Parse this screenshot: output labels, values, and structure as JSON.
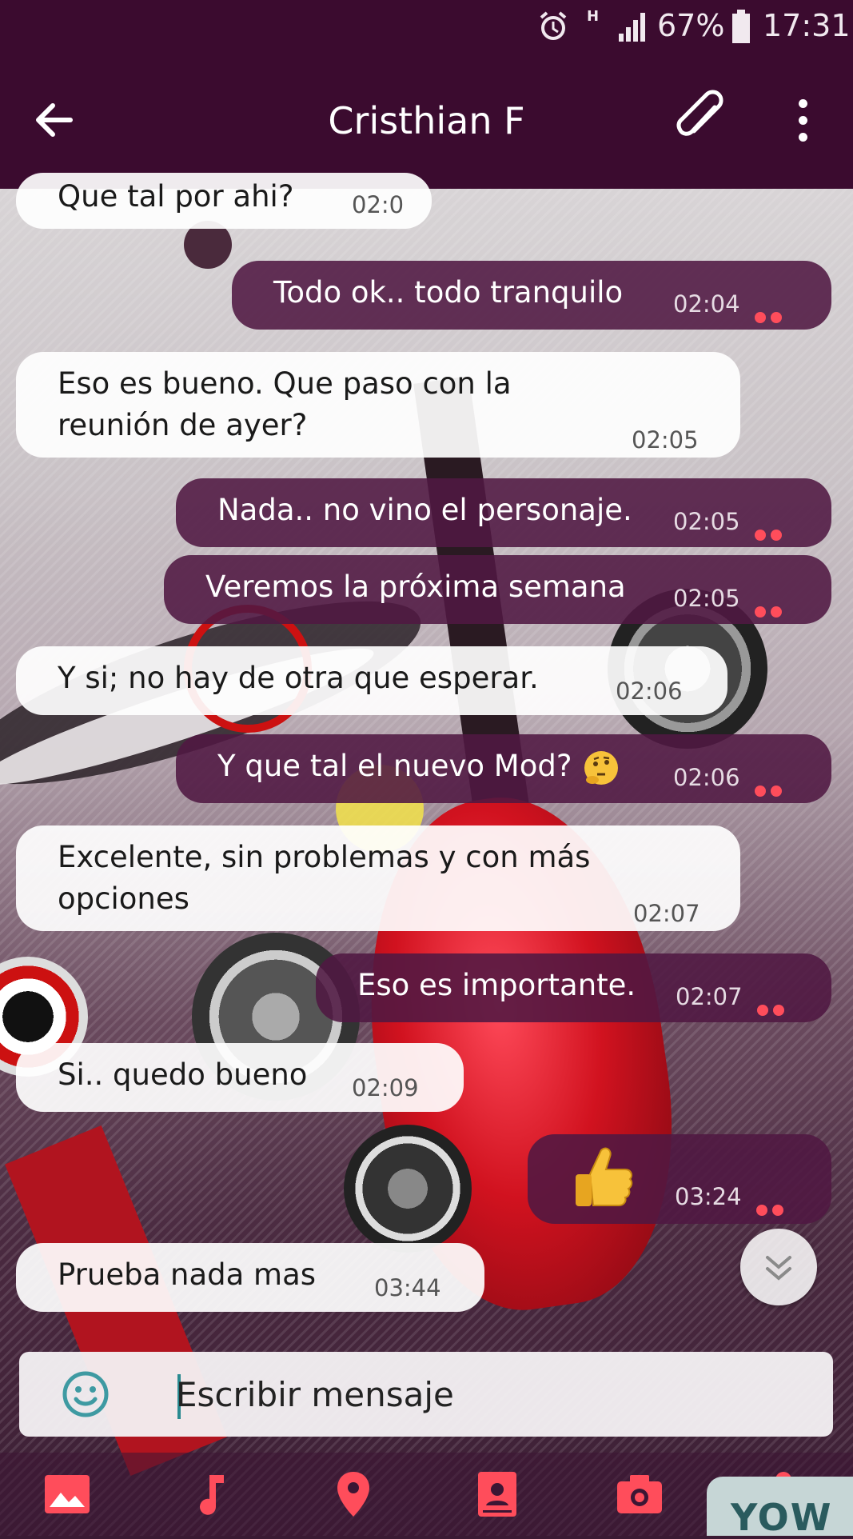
{
  "status_bar": {
    "network_type": "H",
    "battery": "67%",
    "time": "17:31",
    "icons": [
      "alarm-icon",
      "network-h-icon",
      "signal-icon",
      "battery-icon"
    ]
  },
  "header": {
    "title": "Cristhian F",
    "back_icon": "arrow-left-icon",
    "attach_icon": "paperclip-icon",
    "menu_icon": "more-vert-icon"
  },
  "messages": [
    {
      "direction": "in",
      "text": "Que tal por ahi?",
      "time": "02:0"
    },
    {
      "direction": "out",
      "text": "Todo ok.. todo tranquilo",
      "time": "02:04"
    },
    {
      "direction": "in",
      "text": "Eso es bueno. Que paso con la reunión de ayer?",
      "time": "02:05"
    },
    {
      "direction": "out",
      "text": "Nada.. no vino el personaje.",
      "time": "02:05"
    },
    {
      "direction": "out",
      "text": "Veremos la próxima semana",
      "time": "02:05"
    },
    {
      "direction": "in",
      "text": "Y si; no hay de otra que esperar.",
      "time": "02:06"
    },
    {
      "direction": "out",
      "text": "Y que tal el nuevo Mod?",
      "time": "02:06",
      "emoji": "thinking-face-emoji"
    },
    {
      "direction": "in",
      "text": "Excelente, sin problemas y con más opciones",
      "time": "02:07"
    },
    {
      "direction": "out",
      "text": "Eso es importante.",
      "time": "02:07"
    },
    {
      "direction": "in",
      "text": "Si.. quedo bueno",
      "time": "02:09"
    },
    {
      "direction": "out",
      "text": "",
      "time": "03:24",
      "emoji": "thumbs-up-emoji"
    },
    {
      "direction": "in",
      "text": "Prueba nada mas",
      "time": "03:44"
    }
  ],
  "composer": {
    "placeholder": "Escribir mensaje",
    "emoji_icon": "smiley-icon"
  },
  "bottom_bar": {
    "items": [
      "gallery-icon",
      "music-icon",
      "location-icon",
      "contact-icon",
      "camera-icon",
      "microphone-icon"
    ],
    "accent": "#ff4d5b",
    "watermark": "YOW"
  },
  "colors": {
    "header_bg": "#3b0b2f",
    "outgoing_bubble": "#501842",
    "incoming_bubble": "#ffffff",
    "tick_color": "#ff4d5b"
  }
}
